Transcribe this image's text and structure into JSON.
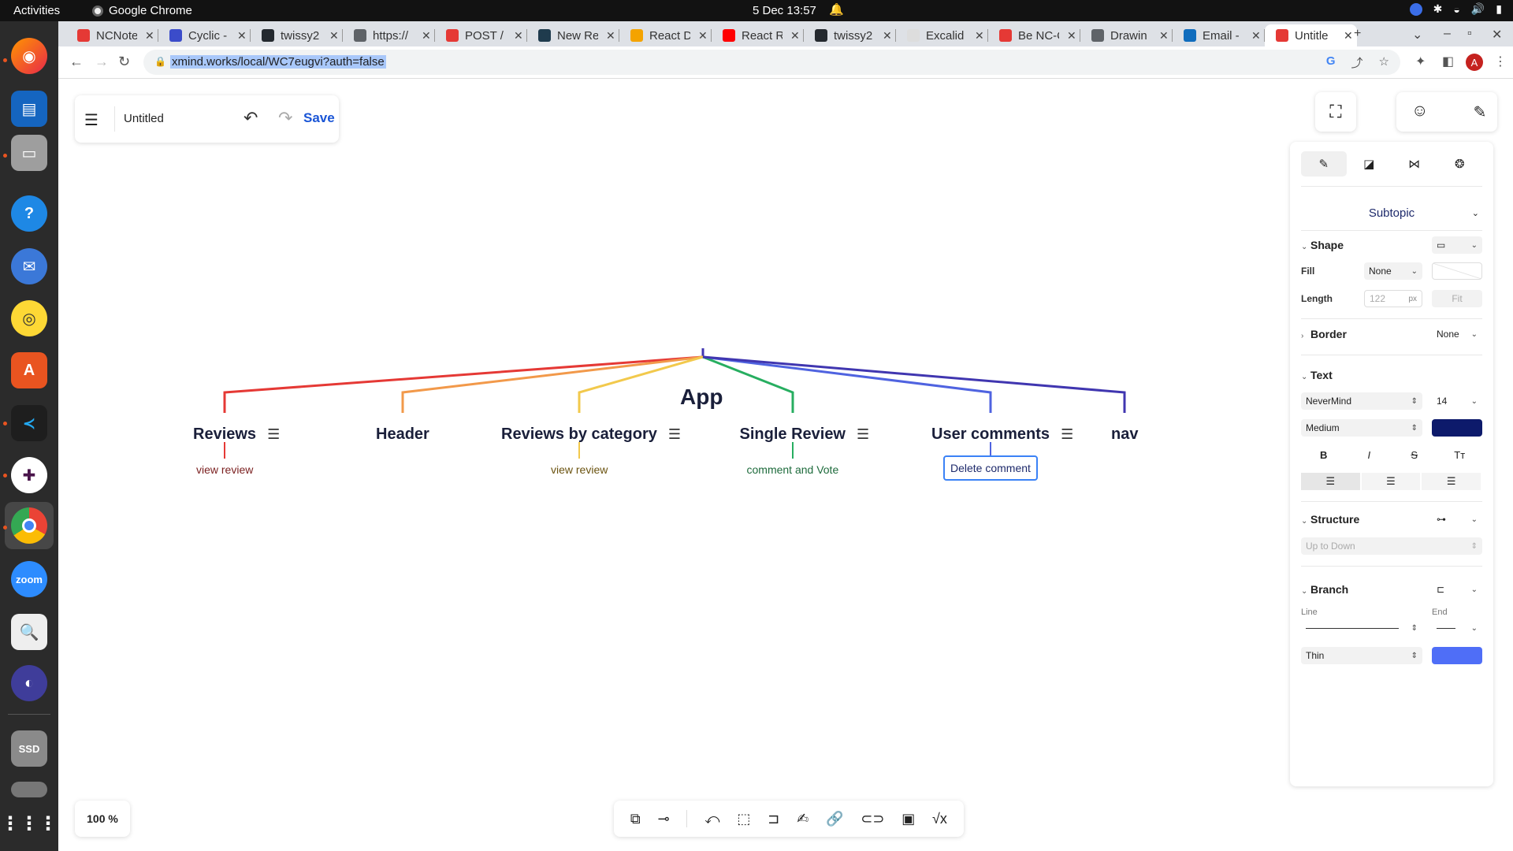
{
  "system": {
    "activities": "Activities",
    "app_name": "Google Chrome",
    "clock": "5 Dec  13:57"
  },
  "browser": {
    "tabs": [
      {
        "label": "NCNote",
        "color": "#e53935"
      },
      {
        "label": "Cyclic -",
        "color": "#3b4cca"
      },
      {
        "label": "twissy2",
        "color": "#24292f"
      },
      {
        "label": "https://",
        "color": "#5f6368"
      },
      {
        "label": "POST /",
        "color": "#e53935"
      },
      {
        "label": "New Re",
        "color": "#1f3b4d"
      },
      {
        "label": "React D",
        "color": "#f4a300"
      },
      {
        "label": "React R",
        "color": "#ff0000"
      },
      {
        "label": "twissy2",
        "color": "#24292f"
      },
      {
        "label": "Excalid",
        "color": "#dddddd"
      },
      {
        "label": "Be NC-C",
        "color": "#e53935"
      },
      {
        "label": "Drawin",
        "color": "#5f6368"
      },
      {
        "label": "Email -",
        "color": "#0f6cbd"
      },
      {
        "label": "Untitle",
        "color": "#e53935",
        "active": true
      }
    ],
    "url": "xmind.works/local/WC7eugvi?auth=false",
    "profile_initial": "A"
  },
  "app": {
    "file_name": "Untitled",
    "save_label": "Save",
    "zoom": "100 %"
  },
  "mindmap": {
    "central": "App",
    "topics": [
      {
        "label": "Reviews",
        "has_note": true,
        "color": "#e53935",
        "subtopic": "view review",
        "sub_color": "#7a1f1f"
      },
      {
        "label": "Header",
        "has_note": false,
        "color": "#f2994a",
        "subtopic": "",
        "sub_color": ""
      },
      {
        "label": "Reviews by category",
        "has_note": true,
        "color": "#f2c94c",
        "subtopic": "view review",
        "sub_color": "#6b5310"
      },
      {
        "label": "Single Review",
        "has_note": true,
        "color": "#27ae60",
        "subtopic": "comment and Vote",
        "sub_color": "#1e6b3c"
      },
      {
        "label": "User comments",
        "has_note": true,
        "color": "#4f63e0",
        "subtopic": "Delete comment",
        "sub_color": "#1e2a6b",
        "sub_selected": true
      },
      {
        "label": "nav",
        "has_note": false,
        "color": "#4036b0",
        "subtopic": "",
        "sub_color": ""
      }
    ]
  },
  "panel": {
    "style_select": "Subtopic",
    "shape": {
      "title": "Shape",
      "fill_label": "Fill",
      "fill_value": "None",
      "length_label": "Length",
      "length_placeholder": "122",
      "length_unit": "px",
      "fit_label": "Fit"
    },
    "border": {
      "title": "Border",
      "value": "None"
    },
    "text": {
      "title": "Text",
      "font": "NeverMind",
      "size": "14",
      "weight": "Medium",
      "color": "#0d1a6b",
      "bold": "B",
      "italic": "I",
      "strike": "S",
      "case": "Tт"
    },
    "structure": {
      "title": "Structure",
      "value": "Up to Down"
    },
    "branch": {
      "title": "Branch",
      "line_label": "Line",
      "end_label": "End",
      "thickness": "Thin",
      "color": "#4f6ef7"
    }
  }
}
